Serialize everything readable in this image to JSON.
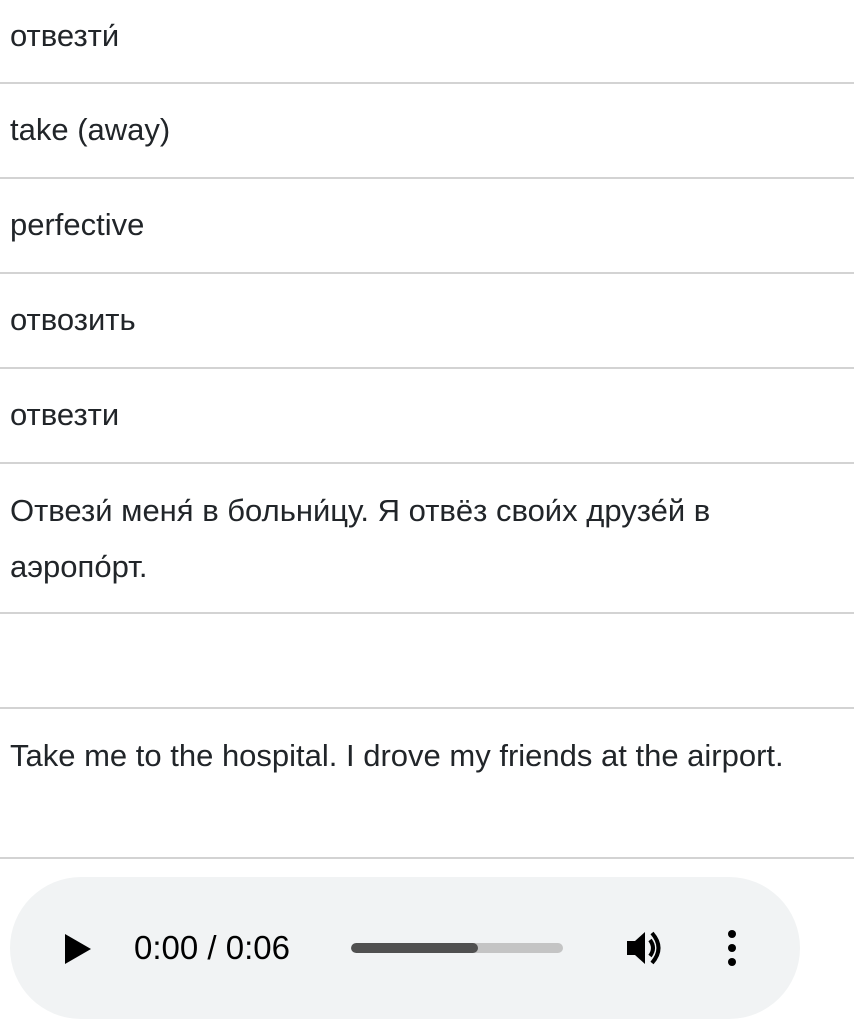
{
  "entry": {
    "headword": "отвезти́",
    "translation": "take (away)",
    "aspect": "perfective",
    "aspect_partner": "отвозить",
    "plain_form": "отвезти",
    "example_ru": "Отвези́ меня́ в больни́цу. Я отвёз свои́х друзе́й в аэропо́рт.",
    "example_blank": "",
    "example_en": "Take me to the hospital. I drove my friends at the airport."
  },
  "audio": {
    "time_display": "0:00 / 0:06",
    "progress_fraction": 0.6,
    "play_icon": "play-icon",
    "volume_icon": "volume-icon",
    "menu_icon": "more-vertical-icon"
  },
  "colors": {
    "divider": "#d3d3d3",
    "player_bg": "#f1f3f4",
    "progress_fill": "#505050",
    "progress_track": "#c4c4c4"
  }
}
